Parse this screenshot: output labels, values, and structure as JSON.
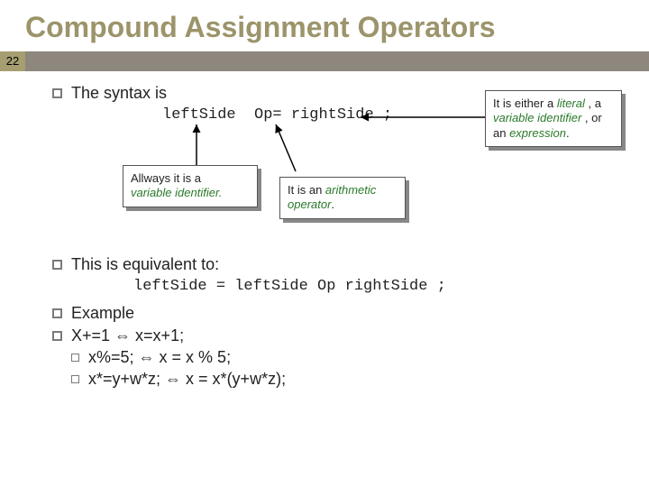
{
  "page_number": "22",
  "title": "Compound Assignment Operators",
  "b1": "The syntax is",
  "syntax": {
    "left": "leftSide",
    "op": "Op=",
    "right": "rightSide ;"
  },
  "calloutL": {
    "line1": "Allways it is a",
    "line2": "variable identifier."
  },
  "calloutR": {
    "line1": "It is an ",
    "em": "arithmetic operator",
    "tail": "."
  },
  "calloutFar": {
    "l1": "It is either a ",
    "em1": "literal",
    "l1b": " , a",
    "em2": "variable identifier",
    "l2b": " , or",
    "l3a": "an ",
    "em3": "expression",
    "l3b": "."
  },
  "b2": "This is equivalent to:",
  "equiv": "leftSide = leftSide Op rightSide ;",
  "b3": "Example",
  "ex1": {
    "lhs": "X+=1 ",
    "rhs": " x=x+1;"
  },
  "ex2": {
    "lhs": "x%=5; ",
    "rhs": " x = x % 5;"
  },
  "ex3": {
    "lhs": "x*=y+w*z; ",
    "rhs": " x = x*(y+w*z);"
  }
}
